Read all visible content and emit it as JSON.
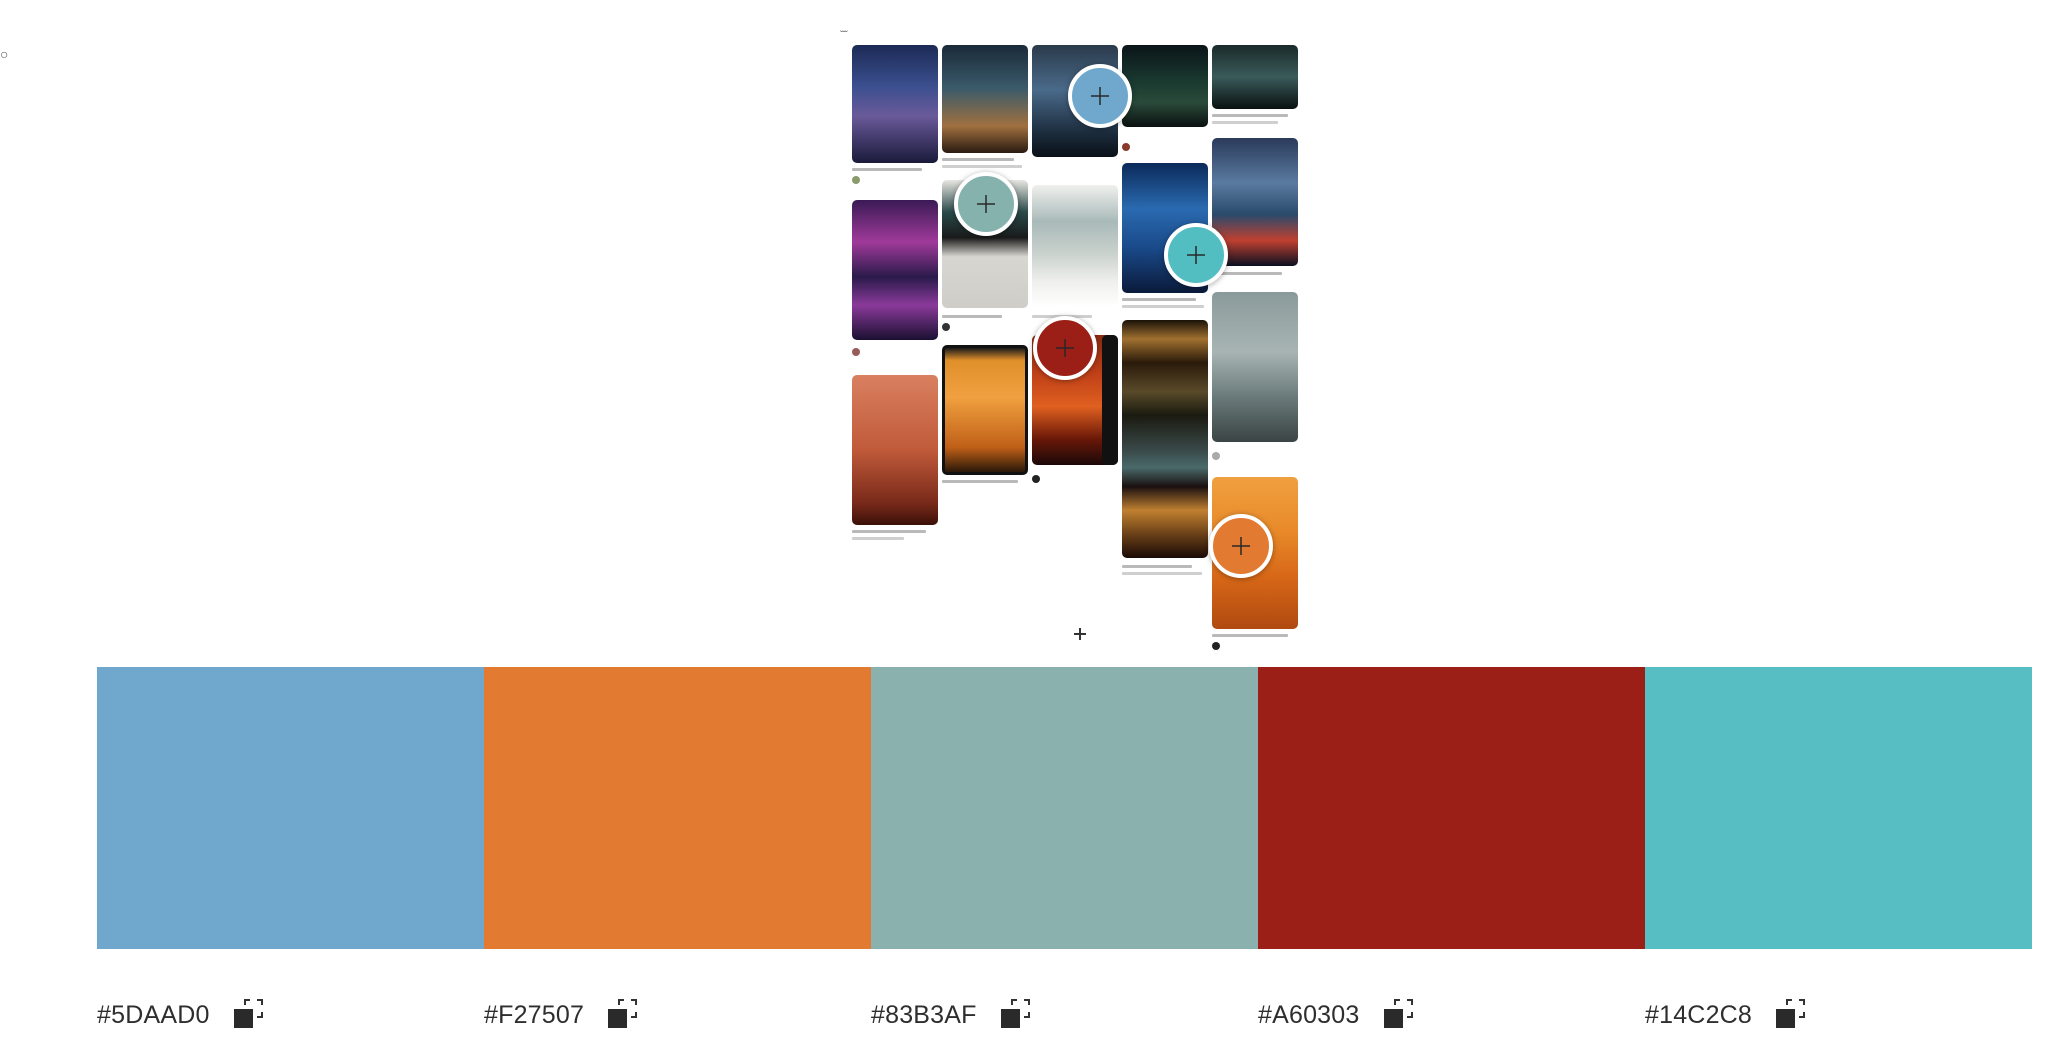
{
  "board": {
    "top_mark": "ˇˇˇ"
  },
  "edge_glyph": "○",
  "samples": [
    {
      "color": "#6FA8CC",
      "label": "+"
    },
    {
      "color": "#86B2AE",
      "label": "+"
    },
    {
      "color": "#52BEC2",
      "label": "+"
    },
    {
      "color": "#9B1F16",
      "label": "+"
    },
    {
      "color": "#E37A31",
      "label": "+"
    }
  ],
  "palette": [
    {
      "hex": "#5DAAD0",
      "display": "#6FA8CC",
      "copy_icon": "copy-icon"
    },
    {
      "hex": "#F27507",
      "display": "#E37A31",
      "copy_icon": "copy-icon"
    },
    {
      "hex": "#83B3AF",
      "display": "#8AB1AE",
      "copy_icon": "copy-icon"
    },
    {
      "hex": "#A60303",
      "display": "#9B1F16",
      "copy_icon": "copy-icon"
    },
    {
      "hex": "#14C2C8",
      "display": "#57BFC4",
      "copy_icon": "copy-icon"
    }
  ]
}
